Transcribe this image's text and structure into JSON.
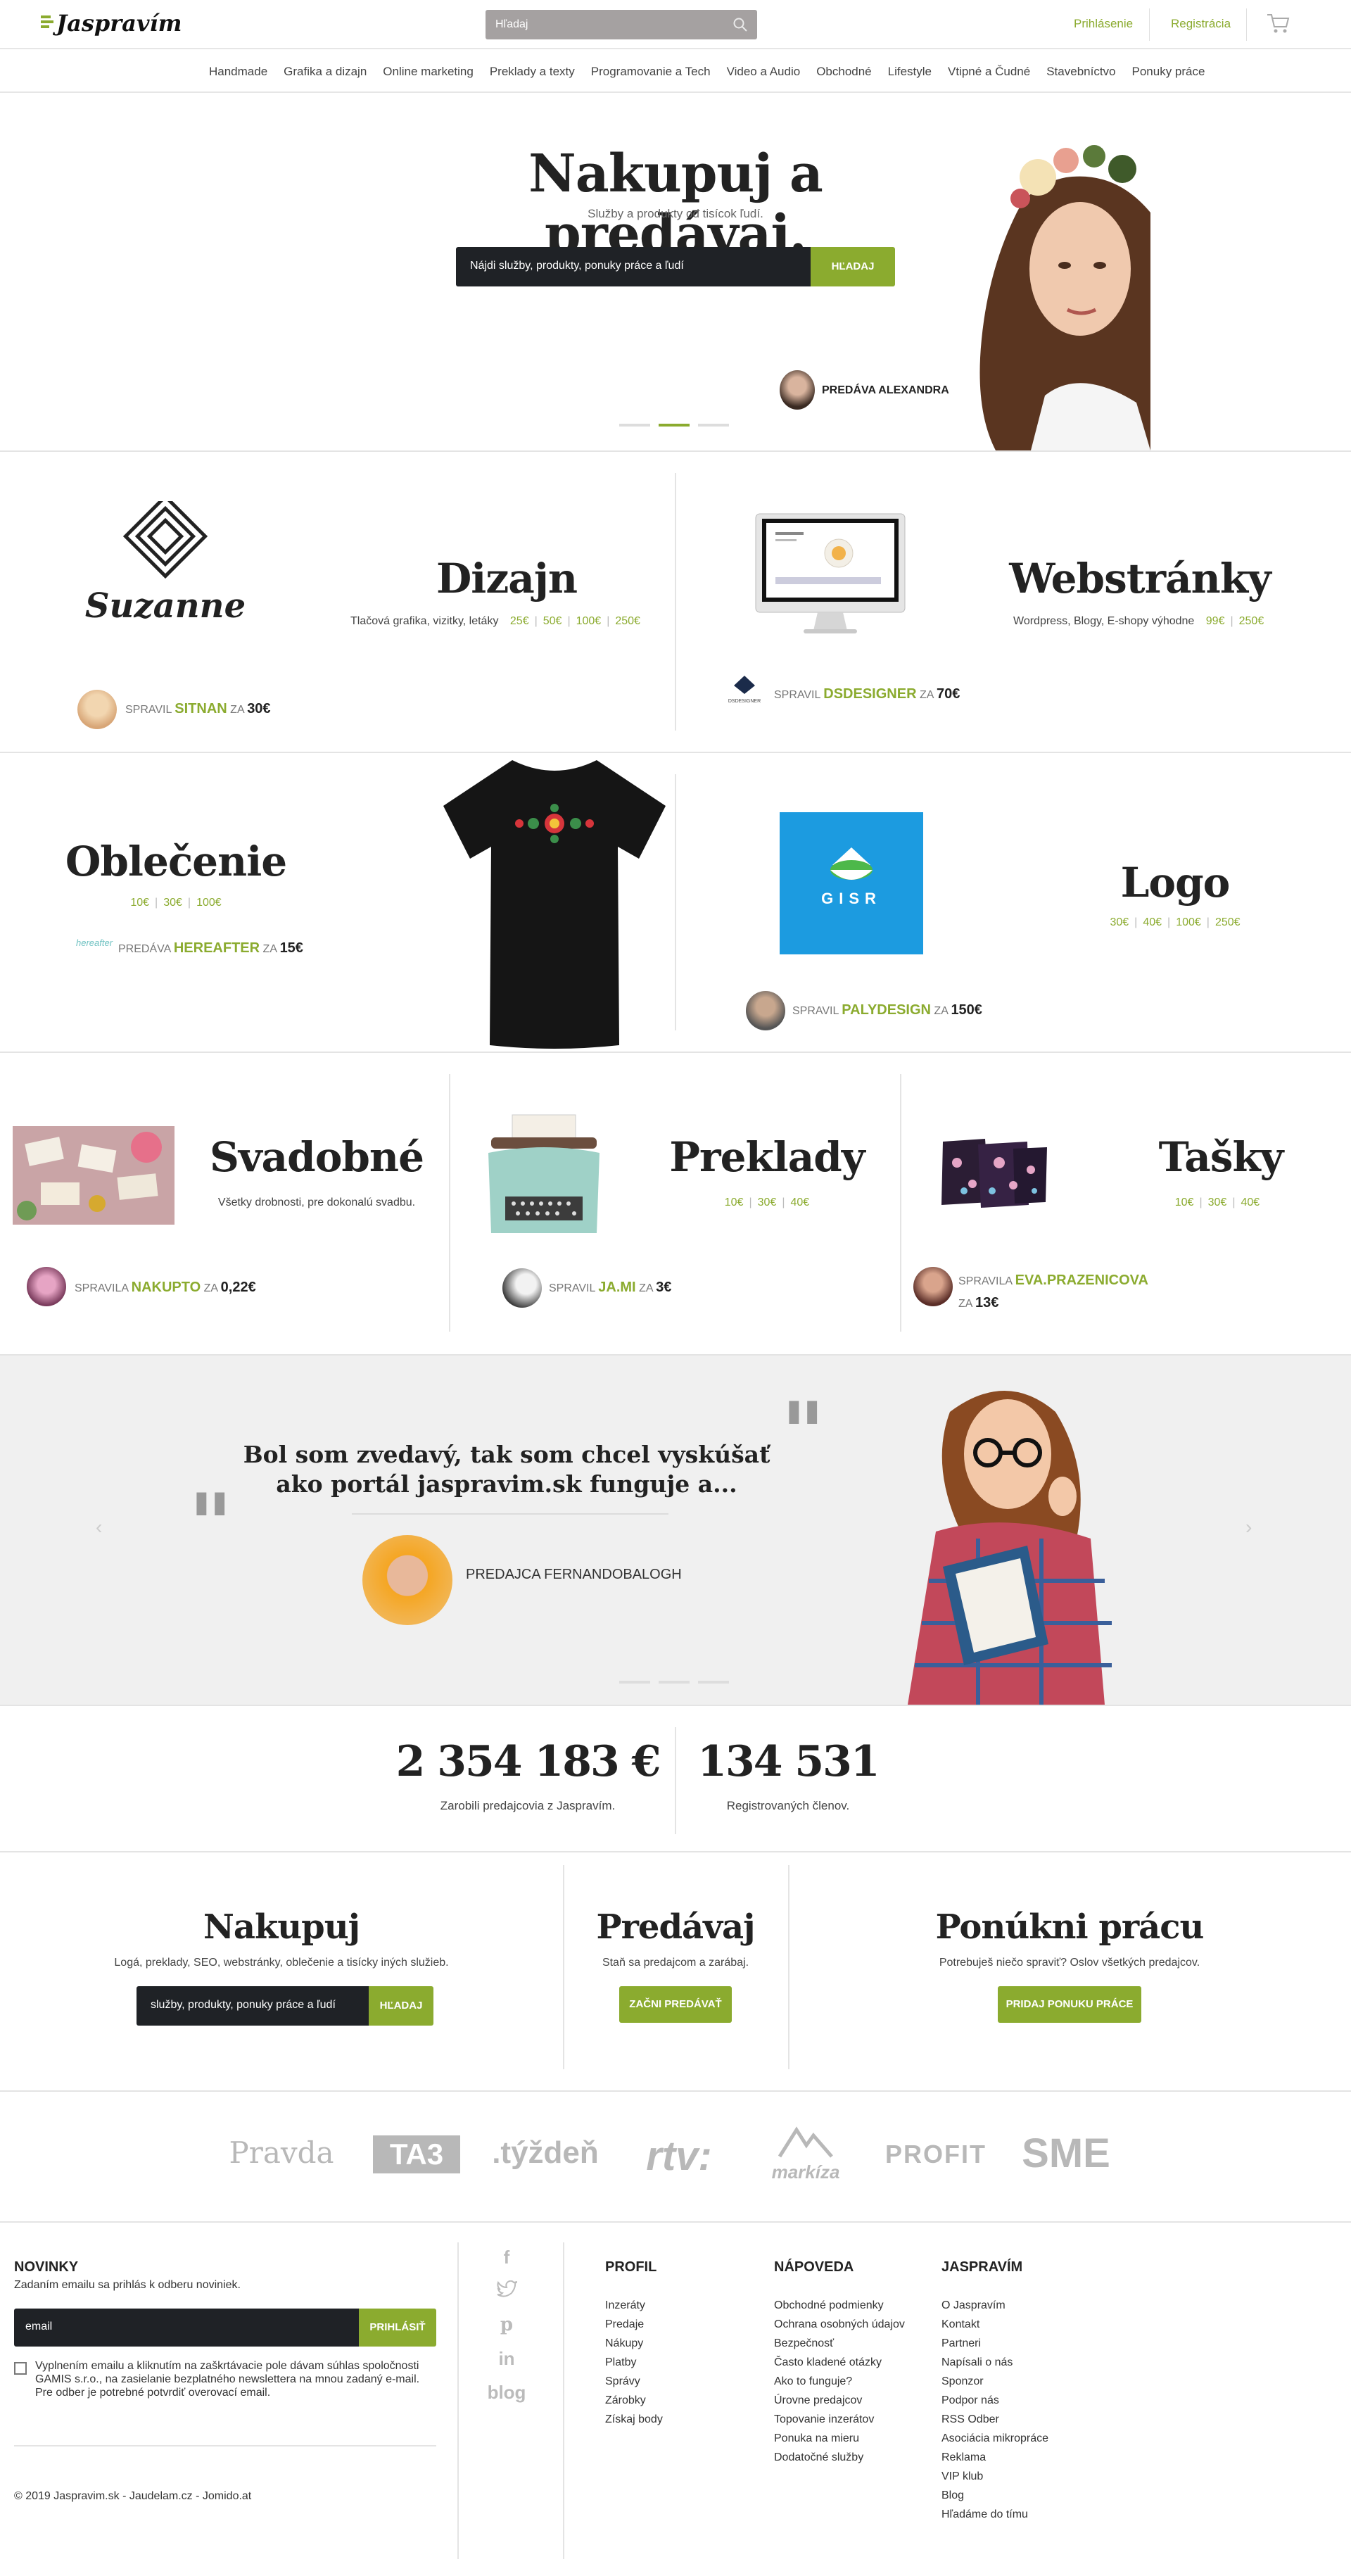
{
  "header": {
    "logo": "Jaspravím",
    "search_placeholder": "Hľadaj",
    "login": "Prihlásenie",
    "register": "Registrácia"
  },
  "categories": [
    "Handmade",
    "Grafika a dizajn",
    "Online marketing",
    "Preklady a texty",
    "Programovanie a Tech",
    "Video a Audio",
    "Obchodné",
    "Lifestyle",
    "Vtipné a Čudné",
    "Stavebníctvo",
    "Ponuky práce"
  ],
  "hero": {
    "title": "Nakupuj a predávaj.",
    "subtitle": "Služby a produkty od tisícok ľudí.",
    "search_placeholder": "Nájdi služby, produkty, ponuky práce a ľudí",
    "search_button": "HĽADAJ",
    "seller": "PREDÁVA ALEXANDRA"
  },
  "features": {
    "dizajn": {
      "title": "Dizajn",
      "sub": "Tlačová grafika, vizitky, letáky",
      "prices": [
        "25€",
        "50€",
        "100€",
        "250€"
      ],
      "by": "SPRAVIL",
      "name": "SITNAN",
      "za": "ZA",
      "price": "30€",
      "logo_text": "Suzanne"
    },
    "web": {
      "title": "Webstránky",
      "sub": "Wordpress, Blogy, E-shopy výhodne",
      "prices": [
        "99€",
        "250€"
      ],
      "by": "SPRAVIL",
      "name": "DSDESIGNER",
      "za": "ZA",
      "price": "70€",
      "avatar_text": "DSDESIGNER"
    },
    "oblecenie": {
      "title": "Oblečenie",
      "prices": [
        "10€",
        "30€",
        "100€"
      ],
      "by": "PREDÁVA",
      "name": "HEREAFTER",
      "za": "ZA",
      "price": "15€",
      "avatar_text": "hereafter"
    },
    "logo": {
      "title": "Logo",
      "prices": [
        "30€",
        "40€",
        "100€",
        "250€"
      ],
      "by": "SPRAVIL",
      "name": "PALYDESIGN",
      "za": "ZA",
      "price": "150€",
      "sample": "GISR"
    },
    "svadobne": {
      "title": "Svadobné",
      "sub": "Všetky drobnosti, pre dokonalú svadbu.",
      "by": "SPRAVILA",
      "name": "NAKUPTO",
      "za": "ZA",
      "price": "0,22€"
    },
    "preklady": {
      "title": "Preklady",
      "prices": [
        "10€",
        "30€",
        "40€"
      ],
      "by": "SPRAVIL",
      "name": "JA.MI",
      "za": "ZA",
      "price": "3€"
    },
    "tasky": {
      "title": "Tašky",
      "prices": [
        "10€",
        "30€",
        "40€"
      ],
      "by": "SPRAVILA",
      "name": "EVA.PRAZENICOVA",
      "za": "ZA",
      "price": "13€"
    }
  },
  "testimonial": {
    "quote": "Bol som zvedavý, tak som chcel vyskúšať ako portál jaspravim.sk funguje a...",
    "author": "PREDAJCA FERNANDOBALOGH"
  },
  "stats": [
    {
      "value": "2 354 183 €",
      "label": "Zarobili predajcovia z Jaspravím."
    },
    {
      "value": "134 531",
      "label": "Registrovaných členov."
    }
  ],
  "cta": {
    "buy": {
      "title": "Nakupuj",
      "sub": "Logá, preklady, SEO, webstránky, oblečenie a tisícky iných služieb.",
      "placeholder": "služby, produkty, ponuky práce a ľudí",
      "button": "HĽADAJ"
    },
    "sell": {
      "title": "Predávaj",
      "sub": "Staň sa predajcom a zarábaj.",
      "button": "ZAČNI PREDÁVAŤ"
    },
    "job": {
      "title": "Ponúkni prácu",
      "sub": "Potrebuješ niečo spraviť? Oslov všetkých predajcov.",
      "button": "PRIDAJ PONUKU PRÁCE"
    }
  },
  "press": [
    "Pravda",
    "TA3",
    ".týždeň",
    "rtv:",
    "markíza",
    "PROFIT",
    "SME"
  ],
  "footer": {
    "news_title": "NOVINKY",
    "news_sub": "Zadaním emailu sa prihlás k odberu noviniek.",
    "email_placeholder": "email",
    "subscribe": "PRIHLÁSIŤ",
    "consent": "Vyplnením emailu a kliknutím na zaškrtávacie pole dávam súhlas spoločnosti GAMIS s.r.o., na zasielanie bezplatného newslettera na mnou zadaný e-mail. Pre odber je potrebné potvrdiť overovací email.",
    "copyright": "© 2019 Jaspravim.sk - Jaudelam.cz - Jomido.at",
    "blog": "blog",
    "profil": {
      "title": "PROFIL",
      "items": [
        "Inzeráty",
        "Predaje",
        "Nákupy",
        "Platby",
        "Správy",
        "Zárobky",
        "Získaj body"
      ]
    },
    "napoveda": {
      "title": "NÁPOVEDA",
      "items": [
        "Obchodné podmienky",
        "Ochrana osobných údajov",
        "Bezpečnosť",
        "Často kladené otázky",
        "Ako to funguje?",
        "Úrovne predajcov",
        "Topovanie inzerátov",
        "Ponuka na mieru",
        "Dodatočné služby"
      ]
    },
    "jaspravim": {
      "title": "JASPRAVÍM",
      "items": [
        "O Jaspravím",
        "Kontakt",
        "Partneri",
        "Napísali o nás",
        "Sponzor",
        "Podpor nás",
        "RSS Odber",
        "Asociácia mikropráce",
        "Reklama",
        "VIP klub",
        "Blog",
        "Hľadáme do tímu"
      ]
    }
  }
}
